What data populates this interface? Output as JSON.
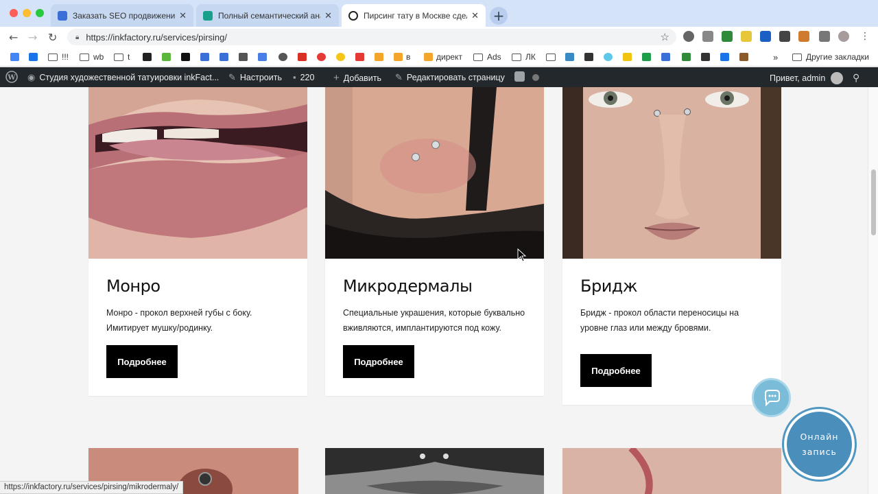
{
  "browser": {
    "tabs": [
      {
        "title": "Заказать SEO продвижение с",
        "icon_color": "#3a6fd8"
      },
      {
        "title": "Полный семантический анал",
        "icon_color": "#18a08a"
      },
      {
        "title": "Пирсинг тату в Москве сдела",
        "icon_color": "#222222"
      }
    ],
    "url": "https://inkfactory.ru/services/pirsing/",
    "new_tab_label": "+"
  },
  "bookmarks": {
    "items": [
      "!!!",
      "wb",
      "t",
      "в",
      "директ",
      "Ads",
      "ЛК"
    ],
    "more": "»",
    "other": "Другие закладки"
  },
  "adminbar": {
    "site": "Студия художественной татуировки inkFact...",
    "customize": "Настроить",
    "comments": "220",
    "add": "Добавить",
    "edit": "Редактировать страницу",
    "greeting": "Привет, admin"
  },
  "cards": [
    {
      "title": "Монро",
      "text": "Монро - прокол верхней губы с боку. Имитирует мушку/родинку.",
      "button": "Подробнее"
    },
    {
      "title": "Микродермалы",
      "text": "Специальные украшения, которые буквально вживляются, имплантируются под кожу.",
      "button": "Подробнее"
    },
    {
      "title": "Бридж",
      "text": "Бридж - прокол области переносицы на уровне глаз или между бровями.",
      "button": "Подробнее"
    }
  ],
  "widgets": {
    "booking_line1": "Онлайн",
    "booking_line2": "запись"
  },
  "status_url": "https://inkfactory.ru/services/pirsing/mikrodermaly/"
}
